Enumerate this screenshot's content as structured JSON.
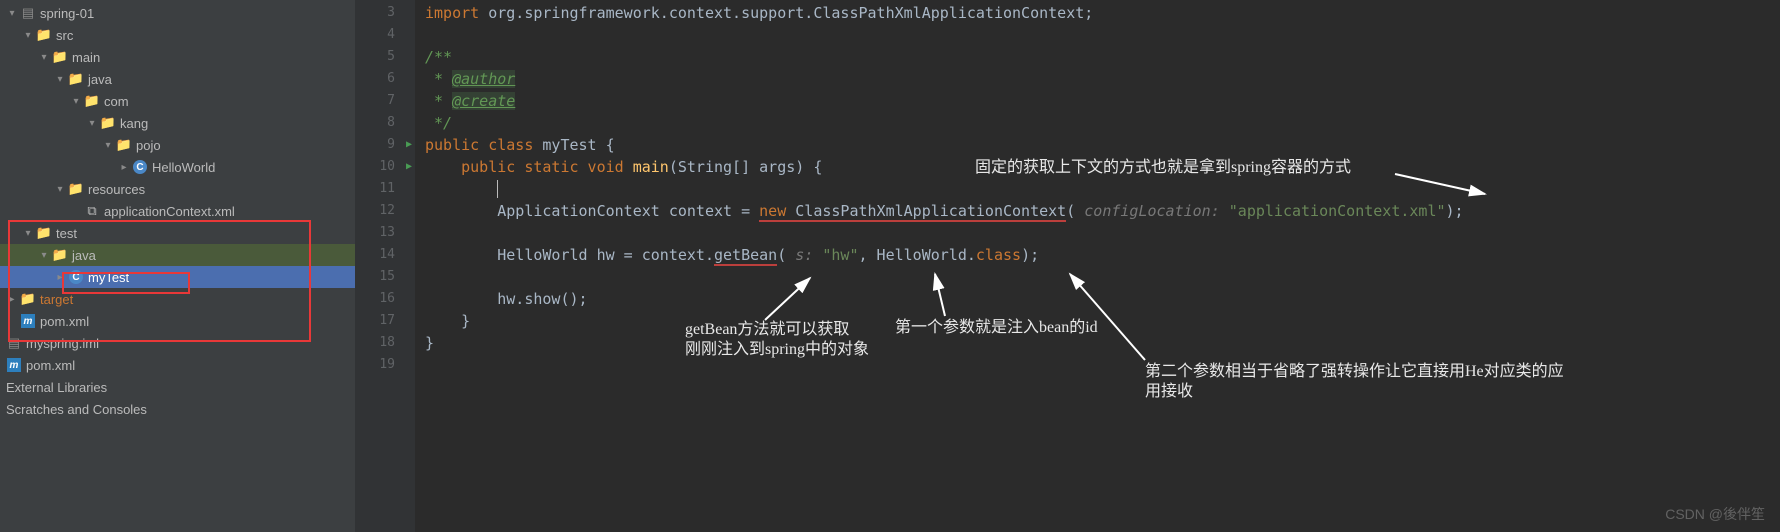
{
  "tree": {
    "spring01": "spring-01",
    "src": "src",
    "main": "main",
    "java_main": "java",
    "com": "com",
    "kang": "kang",
    "pojo": "pojo",
    "helloWorld": "HelloWorld",
    "resources": "resources",
    "appCtx": "applicationContext.xml",
    "test": "test",
    "java_test": "java",
    "myTest": "myTest",
    "target": "target",
    "pomXml": "pom.xml",
    "myspringIml": "myspring.iml",
    "pomXml2": "pom.xml",
    "extLibs": "External Libraries",
    "scratches": "Scratches and Consoles"
  },
  "gutter": [
    "3",
    "4",
    "5",
    "6",
    "7",
    "8",
    "9",
    "10",
    "11",
    "12",
    "13",
    "14",
    "15",
    "16",
    "17",
    "18",
    "19"
  ],
  "code": {
    "l3_import": "import ",
    "l3_pkg": "org.springframework.context.support.ClassPathXmlApplicationContext;",
    "l5": "/**",
    "l6_star": " * ",
    "l6_tag": "@author",
    "l7_star": " * ",
    "l7_tag": "@create",
    "l8": " */",
    "l9_pub": "public class ",
    "l9_cls": "myTest ",
    "l9_brace": "{",
    "l10_mods": "public static void ",
    "l10_main": "main",
    "l10_args": "(String[] args) {",
    "l12_t1": "ApplicationContext context = ",
    "l12_new": "new ",
    "l12_ctor": "ClassPathXmlApplicationContext",
    "l12_hint": "configLocation:",
    "l12_str": "\"applicationContext.xml\"",
    "l12_end": ");",
    "l14_t1": "HelloWorld hw = context.",
    "l14_gb": "getBean",
    "l14_p": "(",
    "l14_hint": "s:",
    "l14_str": "\"hw\"",
    "l14_mid": ", HelloWorld.",
    "l14_kw": "class",
    "l14_end": ");",
    "l16": "hw.show();",
    "l17": "}",
    "l18": "}"
  },
  "annotations": {
    "a1": "固定的获取上下文的方式也就是拿到spring容器的方式",
    "a2_l1": "getBean方法就可以获取",
    "a2_l2": "刚刚注入到spring中的对象",
    "a3": "第一个参数就是注入bean的id",
    "a4_l1": "第二个参数相当于省略了强转操作让它直接用He对应类的应",
    "a4_l2": "用接收"
  },
  "watermark": "CSDN @後伴笙"
}
